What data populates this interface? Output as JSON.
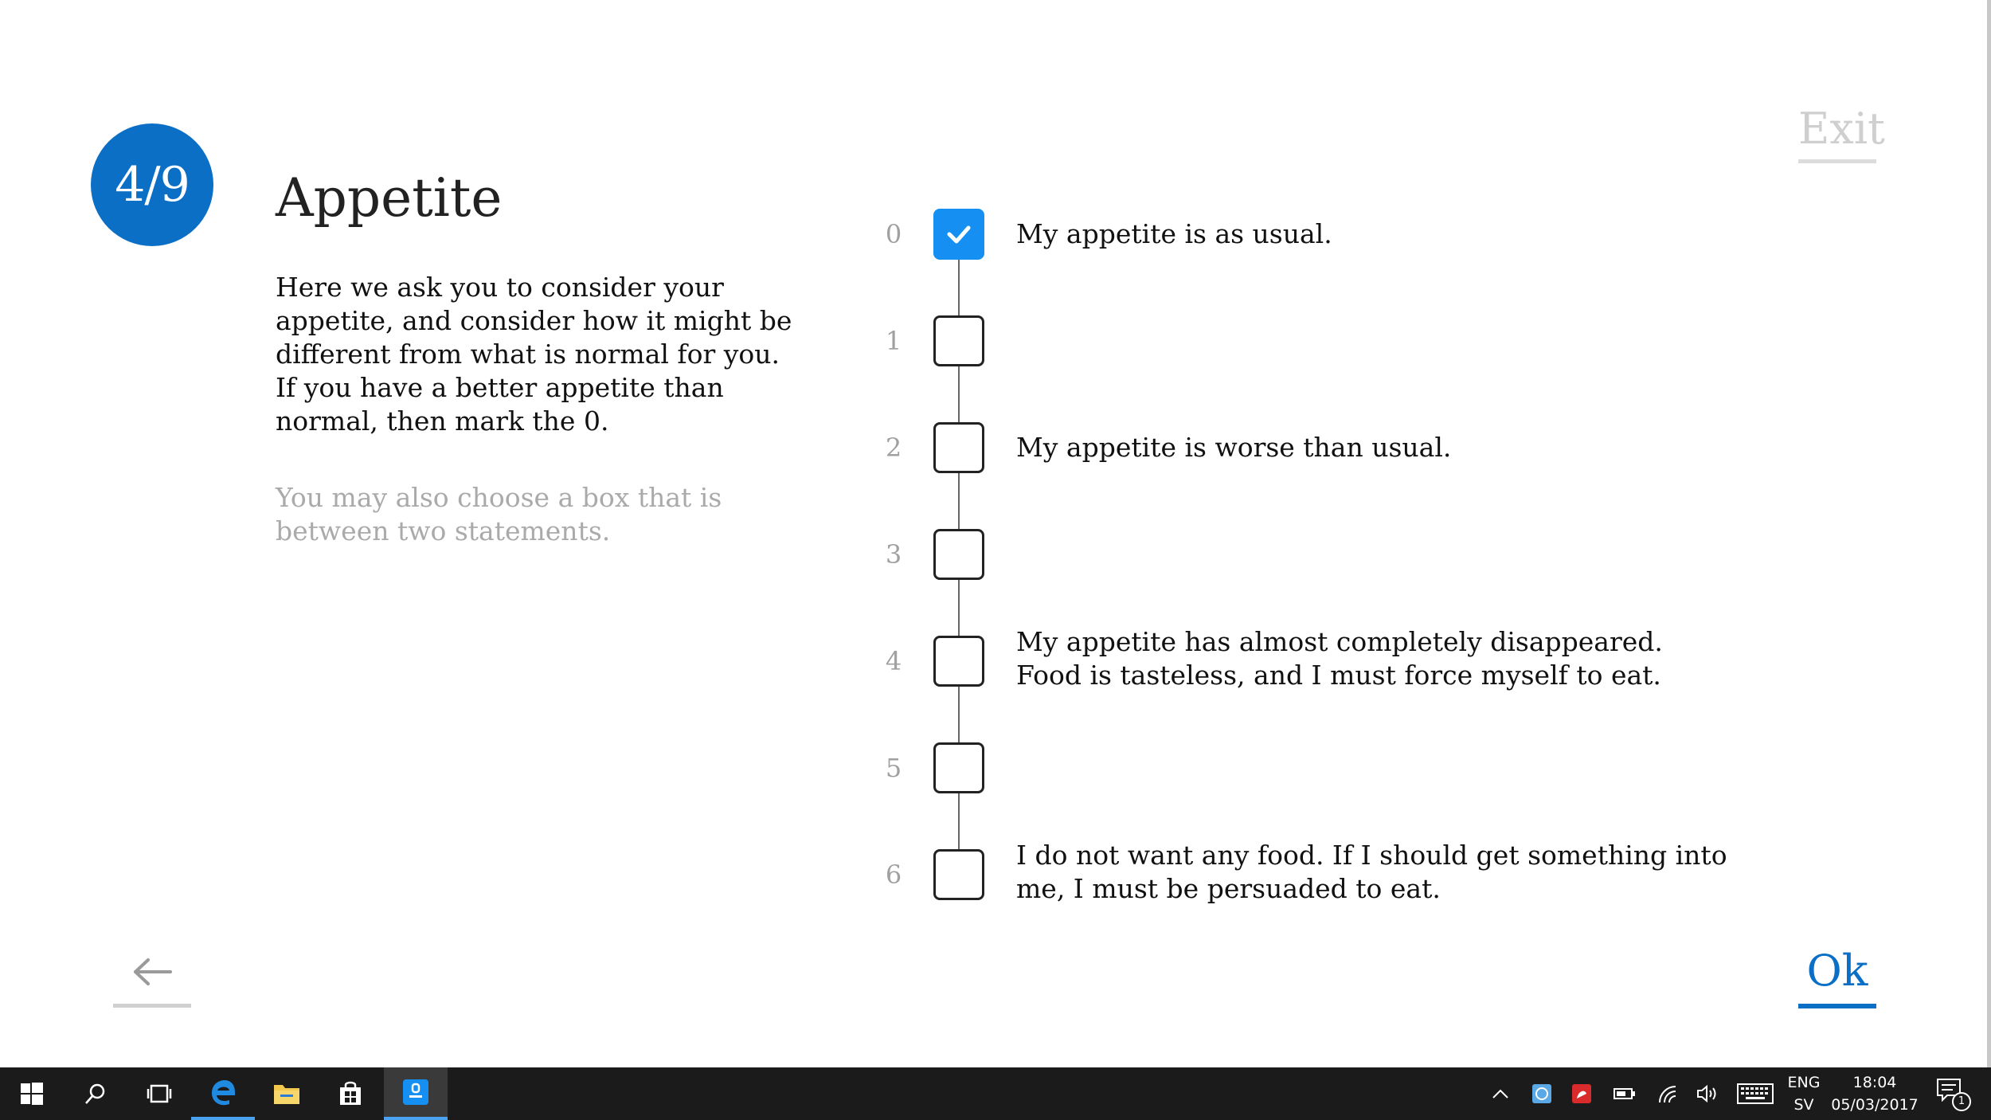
{
  "progress": {
    "label": "4/9"
  },
  "header": {
    "title": "Appetite",
    "exit_label": "Exit"
  },
  "instructions": {
    "main": "Here we ask you to consider your appetite, and consider how it might be different from what is normal for you. If you have a better appetite than normal, then mark the 0.",
    "hint": "You may also choose a box that is between two statements."
  },
  "options": [
    {
      "number": "0",
      "text": "My appetite is as usual.",
      "checked": true
    },
    {
      "number": "1",
      "text": "",
      "checked": false
    },
    {
      "number": "2",
      "text": "My appetite is worse than usual.",
      "checked": false
    },
    {
      "number": "3",
      "text": "",
      "checked": false
    },
    {
      "number": "4",
      "text": "My appetite has almost completely disappeared. Food is tasteless, and I must force myself to eat.",
      "checked": false
    },
    {
      "number": "5",
      "text": "",
      "checked": false
    },
    {
      "number": "6",
      "text": "I do not want any food. If I should get something into me, I must be persuaded to eat.",
      "checked": false
    }
  ],
  "navigation": {
    "ok_label": "Ok",
    "back_icon": "arrow-left-icon"
  },
  "colors": {
    "accent": "#0b6fc6",
    "checked": "#1590f2",
    "muted": "#aaaaaa"
  },
  "taskbar": {
    "language_line1": "ENG",
    "language_line2": "SV",
    "time": "18:04",
    "date": "05/03/2017",
    "notification_count": "1"
  }
}
